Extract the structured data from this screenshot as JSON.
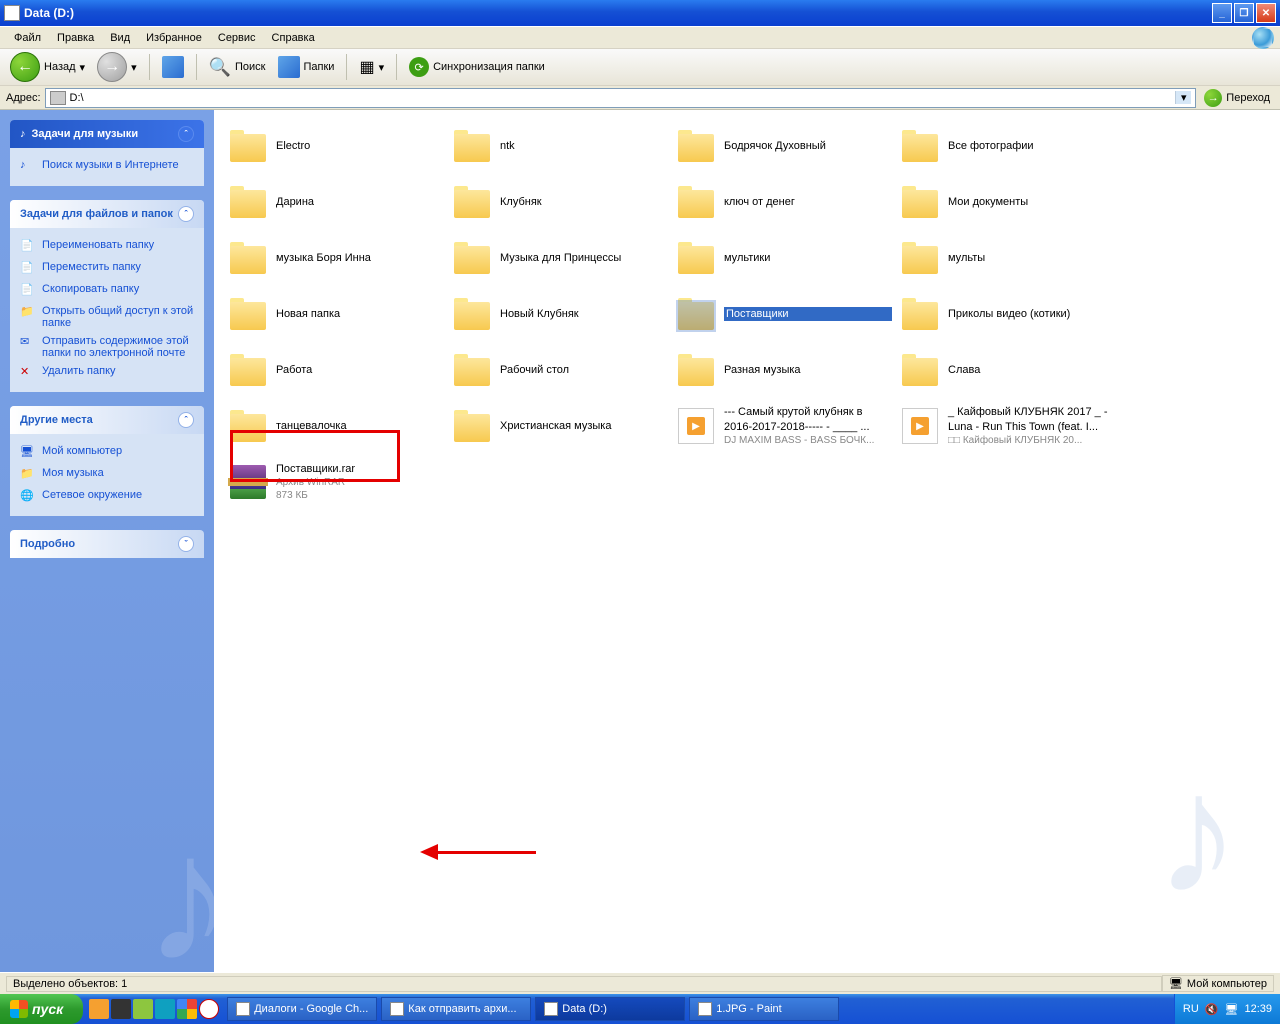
{
  "title": "Data (D:)",
  "menu": [
    "Файл",
    "Правка",
    "Вид",
    "Избранное",
    "Сервис",
    "Справка"
  ],
  "toolbar": {
    "back": "Назад",
    "search": "Поиск",
    "folders": "Папки",
    "sync": "Синхронизация папки"
  },
  "addressbar": {
    "label": "Адрес:",
    "value": "D:\\",
    "go": "Переход"
  },
  "sidepanel": {
    "music": {
      "title": "Задачи для музыки",
      "tasks": [
        {
          "label": "Поиск музыки в Интернете"
        }
      ]
    },
    "fileTasks": {
      "title": "Задачи для файлов и папок",
      "tasks": [
        {
          "label": "Переименовать папку"
        },
        {
          "label": "Переместить папку"
        },
        {
          "label": "Скопировать папку"
        },
        {
          "label": "Открыть общий доступ к этой папке"
        },
        {
          "label": "Отправить содержимое этой папки по электронной почте"
        },
        {
          "label": "Удалить папку"
        }
      ]
    },
    "other": {
      "title": "Другие места",
      "tasks": [
        {
          "label": "Мой компьютер"
        },
        {
          "label": "Моя музыка"
        },
        {
          "label": "Сетевое окружение"
        }
      ]
    },
    "details": {
      "title": "Подробно"
    }
  },
  "files": [
    {
      "type": "folder",
      "name": "Electro"
    },
    {
      "type": "folder",
      "name": "ntk"
    },
    {
      "type": "folder",
      "name": "Бодрячок Духовный"
    },
    {
      "type": "folder",
      "name": "Все фотографии"
    },
    {
      "type": "folder",
      "name": "Дарина"
    },
    {
      "type": "folder",
      "name": "Клубняк"
    },
    {
      "type": "folder",
      "name": "ключ от денег"
    },
    {
      "type": "folder",
      "name": "Мои документы"
    },
    {
      "type": "folder",
      "name": "музыка Боря Инна"
    },
    {
      "type": "folder",
      "name": "Музыка для Принцессы"
    },
    {
      "type": "folder",
      "name": "мультики"
    },
    {
      "type": "folder",
      "name": "мульты"
    },
    {
      "type": "folder",
      "name": "Новая папка"
    },
    {
      "type": "folder",
      "name": "Новый Клубняк"
    },
    {
      "type": "folder",
      "name": "Поставщики",
      "selected": true
    },
    {
      "type": "folder",
      "name": "Приколы видео (котики)"
    },
    {
      "type": "folder",
      "name": "Работа"
    },
    {
      "type": "folder",
      "name": "Рабочий стол"
    },
    {
      "type": "folder",
      "name": "Разная музыка"
    },
    {
      "type": "folder",
      "name": "Слава"
    },
    {
      "type": "folder",
      "name": "танцевалочка"
    },
    {
      "type": "folder",
      "name": "Христианская музыка"
    },
    {
      "type": "media",
      "name": "--- Самый крутой клубняк в 2016-2017-2018----- - ____ ...",
      "sub": "DJ MAXIM BASS - BASS БОЧК..."
    },
    {
      "type": "media",
      "name": "_ Кайфовый КЛУБНЯК 2017 _ - Luna - Run This Town (feat. I...",
      "sub": "□□ Кайфовый КЛУБНЯК 20..."
    },
    {
      "type": "rar",
      "name": "Поставщики.rar",
      "sub": "Архив WinRAR",
      "sub2": "873 КБ",
      "highlighted": true
    }
  ],
  "statusbar": {
    "left": "Выделено объектов: 1",
    "right": "Мой компьютер"
  },
  "taskbar": {
    "start": "пуск",
    "items": [
      {
        "label": "Диалоги - Google Ch..."
      },
      {
        "label": "Как отправить архи..."
      },
      {
        "label": "Data (D:)",
        "active": true
      },
      {
        "label": "1.JPG - Paint"
      }
    ],
    "lang": "RU",
    "time": "12:39"
  }
}
